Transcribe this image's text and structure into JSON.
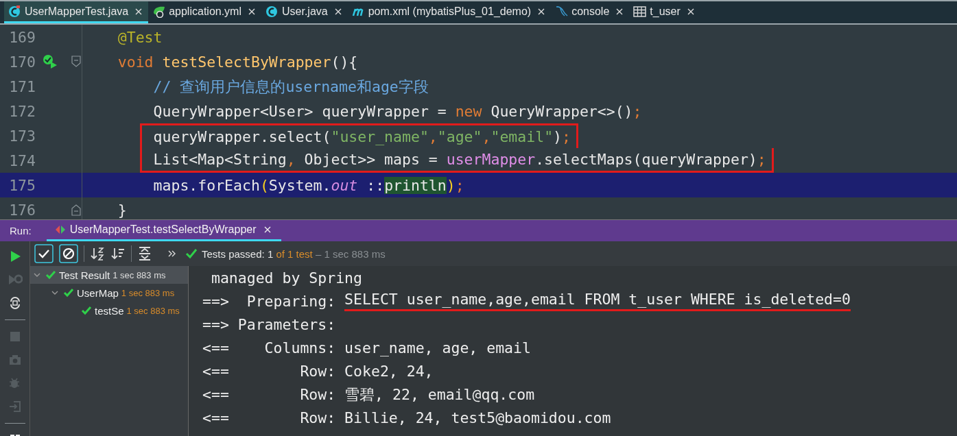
{
  "editor_tabs": [
    {
      "label": "UserMapperTest.java",
      "selected": true
    },
    {
      "label": "application.yml",
      "selected": false
    },
    {
      "label": "User.java",
      "selected": false
    },
    {
      "label": "pom.xml (mybatisPlus_01_demo)",
      "selected": false
    },
    {
      "label": "console",
      "selected": false
    },
    {
      "label": "t_user",
      "selected": false
    }
  ],
  "editor": {
    "lines": [
      {
        "number": "169",
        "kind": "plain",
        "current": false,
        "boxed": false,
        "tokens": [
          {
            "text": "    @Test",
            "kind": "annotation"
          }
        ]
      },
      {
        "number": "170",
        "kind": "test-method",
        "current": false,
        "boxed": false,
        "tokens": [
          {
            "text": "    void ",
            "kind": "keyword"
          },
          {
            "text": "testSelectByWrapper",
            "kind": "method"
          },
          {
            "text": "(){",
            "kind": "plain"
          }
        ]
      },
      {
        "number": "171",
        "kind": "plain",
        "current": false,
        "boxed": false,
        "tokens": [
          {
            "text": "        // 查询用户信息的username和age字段",
            "kind": "comment"
          }
        ]
      },
      {
        "number": "172",
        "kind": "plain",
        "current": false,
        "boxed": false,
        "tokens": [
          {
            "text": "        QueryWrapper<User> queryWrapper = ",
            "kind": "plain"
          },
          {
            "text": "new ",
            "kind": "keyword"
          },
          {
            "text": "QueryWrapper<>()",
            "kind": "plain"
          },
          {
            "text": ";",
            "kind": "keyword"
          }
        ]
      },
      {
        "number": "173",
        "kind": "plain",
        "current": false,
        "boxed": true,
        "tokens": [
          {
            "text": "        queryWrapper.select(",
            "kind": "plain"
          },
          {
            "text": "\"user_name\"",
            "kind": "string"
          },
          {
            "text": ",",
            "kind": "keyword"
          },
          {
            "text": "\"age\"",
            "kind": "string"
          },
          {
            "text": ",",
            "kind": "keyword"
          },
          {
            "text": "\"email\"",
            "kind": "string"
          },
          {
            "text": ")",
            "kind": "plain"
          },
          {
            "text": ";",
            "kind": "keyword"
          }
        ]
      },
      {
        "number": "174",
        "kind": "plain",
        "current": false,
        "boxed": true,
        "tokens": [
          {
            "text": "        List<Map<String",
            "kind": "plain"
          },
          {
            "text": ", ",
            "kind": "keyword"
          },
          {
            "text": "Object>> maps = ",
            "kind": "plain"
          },
          {
            "text": "userMapper",
            "kind": "field"
          },
          {
            "text": ".selectMaps(queryWrapper)",
            "kind": "plain"
          },
          {
            "text": ";",
            "kind": "keyword"
          }
        ]
      },
      {
        "number": "175",
        "kind": "plain",
        "current": true,
        "boxed": false,
        "tokens": [
          {
            "text": "        maps.forEach",
            "kind": "plain"
          },
          {
            "text": "(",
            "kind": "paren"
          },
          {
            "text": "System.",
            "kind": "plain"
          },
          {
            "text": "out",
            "kind": "static"
          },
          {
            "text": " ::",
            "kind": "plain"
          },
          {
            "text": "println",
            "kind": "match"
          },
          {
            "text": ")",
            "kind": "paren"
          },
          {
            "text": ";",
            "kind": "keyword"
          }
        ]
      },
      {
        "number": "176",
        "kind": "block-end",
        "current": false,
        "boxed": false,
        "tokens": [
          {
            "text": "    }",
            "kind": "plain"
          }
        ]
      }
    ]
  },
  "run_panel": {
    "label": "Run:",
    "tab": {
      "label": "UserMapperTest.testSelectByWrapper",
      "selected": true
    },
    "status": [
      {
        "text": "Tests passed: ",
        "kind": "plain"
      },
      {
        "text": "1",
        "kind": "plain"
      },
      {
        "text": " of 1 test",
        "kind": "count"
      },
      {
        "text": " – 1 sec 883 ms",
        "kind": "muted"
      }
    ],
    "tree": [
      {
        "label": "Test Result",
        "time": "1 sec 883 ms",
        "selected": true,
        "expanded": true,
        "children": [
          {
            "label": "UserMap",
            "time": "1 sec 883 ms",
            "selected": false,
            "expanded": true,
            "children": [
              {
                "label": "testSe",
                "time": "1 sec 883 ms",
                "selected": false
              }
            ]
          }
        ]
      }
    ],
    "console": [
      {
        "text": " managed by Spring"
      },
      {
        "text": "==>  Preparing: ",
        "sql": "SELECT user_name,age,email FROM t_user WHERE is_deleted=0"
      },
      {
        "text": "==> Parameters:"
      },
      {
        "text": "<==    Columns: user_name, age, email"
      },
      {
        "text": "<==        Row: Coke2, 24,"
      },
      {
        "text": "<==        Row: 雪碧, 22, email@qq.com"
      },
      {
        "text": "<==        Row: Billie, 24, test5@baomidou.com"
      }
    ]
  }
}
